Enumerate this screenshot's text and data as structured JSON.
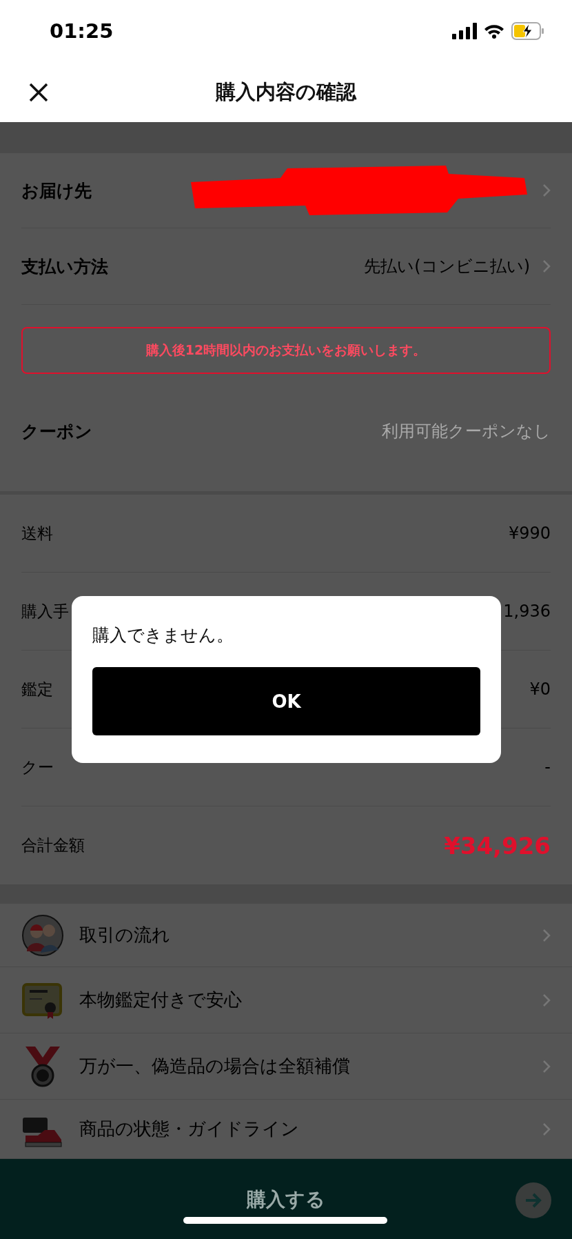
{
  "status_bar": {
    "time": "01:25",
    "battery_charging": true
  },
  "header": {
    "title": "購入内容の確認"
  },
  "order_rows": [
    {
      "label": "お届け先",
      "redacted": true
    },
    {
      "label": "支払い方法",
      "value": "先払い(コンビニ払い)",
      "redacted": false
    }
  ],
  "notice": "購入後12時間以内のお支払いをお願いします。",
  "coupon": {
    "label": "クーポン",
    "value": "利用可能クーポンなし",
    "disabled": true
  },
  "fees": [
    {
      "label": "送料",
      "value": "¥990",
      "kind": "line"
    },
    {
      "label": "購入手",
      "value": "1,936",
      "kind": "line"
    },
    {
      "label": "鑑定",
      "value": "¥0",
      "kind": "line"
    },
    {
      "label": "クー",
      "value": "-",
      "kind": "line"
    },
    {
      "label": "合計金額",
      "value": "¥34,926",
      "kind": "total"
    }
  ],
  "info_items": [
    {
      "label": "取引の流れ",
      "kind": "people"
    },
    {
      "label": "本物鑑定付きで安心",
      "kind": "certificate"
    },
    {
      "label": "万が一、偽造品の場合は全額補償",
      "kind": "medal"
    },
    {
      "label": "商品の状態・ガイドライン",
      "kind": "sneaker"
    }
  ],
  "footer": {
    "button": "購入する"
  },
  "dialog": {
    "message": "購入できません。",
    "button": "OK"
  }
}
